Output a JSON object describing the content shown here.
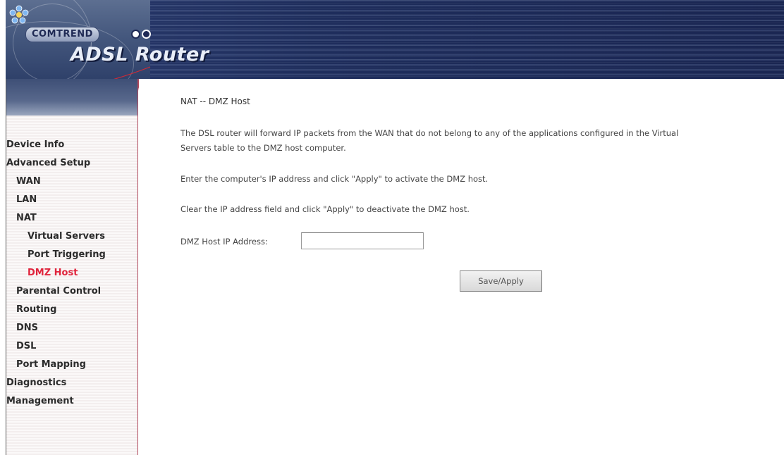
{
  "header": {
    "brand": "COMTREND",
    "product": "ADSL Router"
  },
  "sidebar": {
    "items": [
      {
        "label": "Device Info",
        "level": 0,
        "active": false
      },
      {
        "label": "Advanced Setup",
        "level": 0,
        "active": false
      },
      {
        "label": "WAN",
        "level": 1,
        "active": false
      },
      {
        "label": "LAN",
        "level": 1,
        "active": false
      },
      {
        "label": "NAT",
        "level": 1,
        "active": false
      },
      {
        "label": "Virtual Servers",
        "level": 2,
        "active": false
      },
      {
        "label": "Port Triggering",
        "level": 2,
        "active": false
      },
      {
        "label": "DMZ Host",
        "level": 2,
        "active": true
      },
      {
        "label": "Parental Control",
        "level": 1,
        "active": false
      },
      {
        "label": "Routing",
        "level": 1,
        "active": false
      },
      {
        "label": "DNS",
        "level": 1,
        "active": false
      },
      {
        "label": "DSL",
        "level": 1,
        "active": false
      },
      {
        "label": "Port Mapping",
        "level": 1,
        "active": false
      },
      {
        "label": "Diagnostics",
        "level": 0,
        "active": false
      },
      {
        "label": "Management",
        "level": 0,
        "active": false
      }
    ]
  },
  "main": {
    "title": "NAT -- DMZ Host",
    "desc_line1": "The DSL router will forward IP packets from the WAN that do not belong to any of the applications configured in the Virtual",
    "desc_line2": "Servers table to the DMZ host computer.",
    "instruction_activate": "Enter the computer's IP address and click \"Apply\" to activate the DMZ host.",
    "instruction_deactivate": "Clear the IP address field and click \"Apply\" to deactivate the DMZ host.",
    "ip_label": "DMZ Host IP Address:",
    "ip_value": "",
    "apply_label": "Save/Apply"
  },
  "colors": {
    "header_bg": "#1e2d5c",
    "active_nav": "#e0243c",
    "sidebar_border": "#b0485c"
  }
}
